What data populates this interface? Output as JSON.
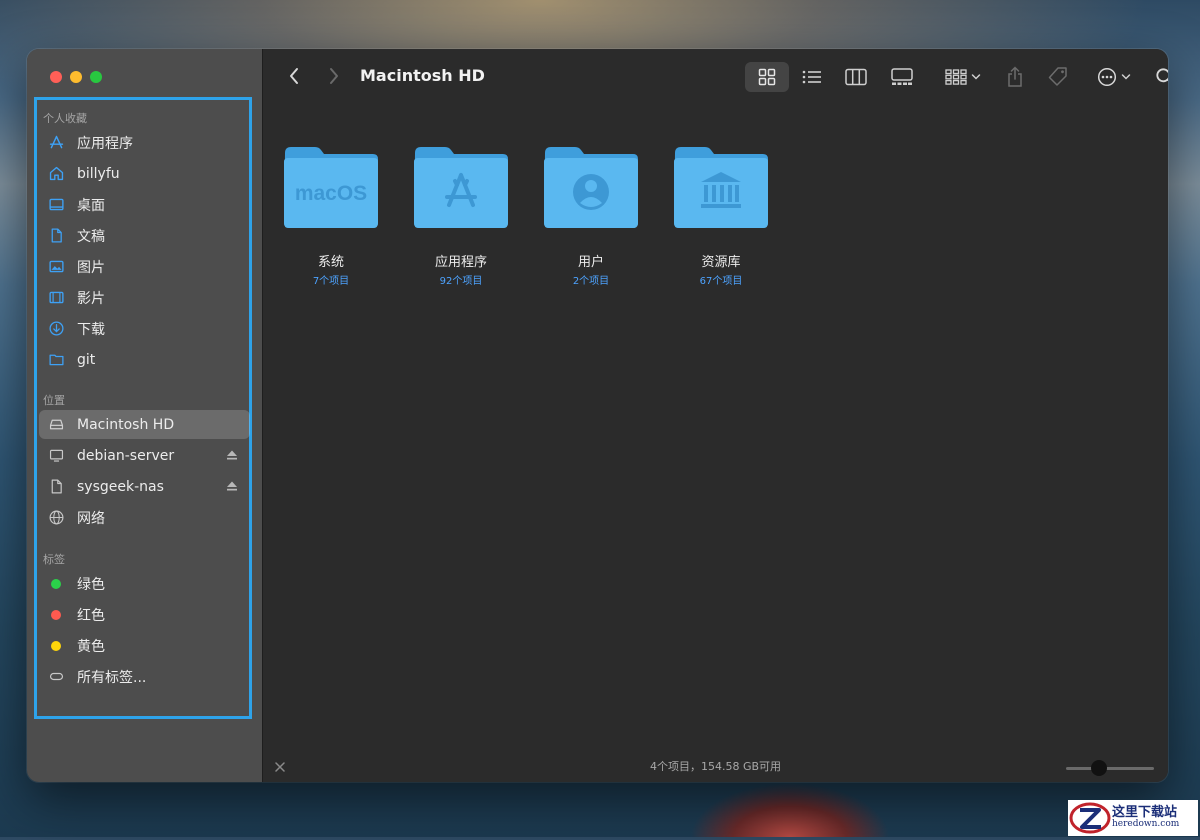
{
  "window": {
    "title": "Macintosh HD"
  },
  "sidebar": {
    "sections": [
      {
        "label": "个人收藏",
        "items": [
          {
            "label": "应用程序",
            "icon": "applications-icon"
          },
          {
            "label": "billyfu",
            "icon": "home-icon"
          },
          {
            "label": "桌面",
            "icon": "desktop-icon"
          },
          {
            "label": "文稿",
            "icon": "document-icon"
          },
          {
            "label": "图片",
            "icon": "photo-icon"
          },
          {
            "label": "影片",
            "icon": "film-icon"
          },
          {
            "label": "下载",
            "icon": "download-icon"
          },
          {
            "label": "git",
            "icon": "folder-icon"
          }
        ]
      },
      {
        "label": "位置",
        "items": [
          {
            "label": "Macintosh HD",
            "icon": "hard-drive-icon",
            "selected": true
          },
          {
            "label": "debian-server",
            "icon": "monitor-icon",
            "ejectable": true
          },
          {
            "label": "sysgeek-nas",
            "icon": "document-icon",
            "ejectable": true
          },
          {
            "label": "网络",
            "icon": "globe-icon"
          }
        ]
      },
      {
        "label": "标签",
        "items": [
          {
            "label": "绿色",
            "color": "#2bd24a"
          },
          {
            "label": "红色",
            "color": "#ff5a4f"
          },
          {
            "label": "黄色",
            "color": "#ffd60a"
          },
          {
            "label": "所有标签...",
            "icon": "tag-outline-icon"
          }
        ]
      }
    ]
  },
  "folders": [
    {
      "name": "系统",
      "count": "7个项目",
      "glyph": "macOS"
    },
    {
      "name": "应用程序",
      "count": "92个项目",
      "glyph": "app-store-icon"
    },
    {
      "name": "用户",
      "count": "2个项目",
      "glyph": "user-icon"
    },
    {
      "name": "资源库",
      "count": "67个项目",
      "glyph": "library-icon"
    }
  ],
  "status_bar": {
    "text": "4个项目，154.58 GB可用"
  },
  "watermark": {
    "cn": "这里下载站",
    "url": "heredown.com"
  },
  "colors": {
    "accent": "#2ea3ea",
    "folder": "#5ab8f0",
    "count_text": "#4da3ff"
  }
}
